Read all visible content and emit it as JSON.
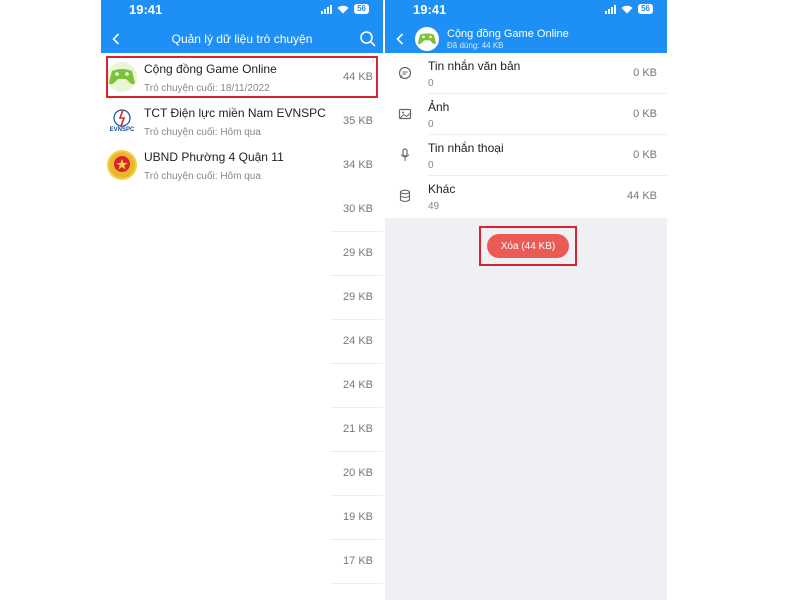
{
  "colors": {
    "header": "#1e90f5",
    "highlight": "#d9232e",
    "delete_button": "#ea5b55"
  },
  "left": {
    "status": {
      "time": "19:41",
      "battery": "56"
    },
    "header": {
      "title": "Quản lý dữ liệu trò chuyện",
      "back_icon": "chevron-left-icon",
      "search_icon": "search-icon"
    },
    "conversations": [
      {
        "name": "Cộng đồng Game Online",
        "last": "Trò chuyện cuối: 18/11/2022",
        "size": "44 KB",
        "avatar": "gamepad-icon"
      },
      {
        "name": "TCT Điện lực miền Nam EVNSPC",
        "last": "Trò chuyện cuối: Hôm qua",
        "size": "35 KB",
        "avatar": "evnspc-logo",
        "logo_text": "EVNSPC"
      },
      {
        "name": "UBND Phường 4 Quận 11",
        "last": "Trò chuyện cuối: Hôm qua",
        "size": "34 KB",
        "avatar": "emblem-icon"
      }
    ],
    "more_sizes": [
      "30 KB",
      "29 KB",
      "29 KB",
      "24 KB",
      "24 KB",
      "21 KB",
      "20 KB",
      "19 KB",
      "17 KB"
    ]
  },
  "right": {
    "status": {
      "time": "19:41",
      "battery": "56"
    },
    "header": {
      "title": "Cộng đồng Game Online",
      "subtitle": "Đã dùng: 44 KB",
      "back_icon": "chevron-left-icon"
    },
    "categories": [
      {
        "label": "Tin nhắn văn bản",
        "count": "0",
        "size": "0 KB",
        "icon": "message-icon"
      },
      {
        "label": "Ảnh",
        "count": "0",
        "size": "0 KB",
        "icon": "image-icon"
      },
      {
        "label": "Tin nhắn thoại",
        "count": "0",
        "size": "0 KB",
        "icon": "microphone-icon"
      },
      {
        "label": "Khác",
        "count": "49",
        "size": "44 KB",
        "icon": "database-icon"
      }
    ],
    "delete_button": "Xóa (44 KB)"
  }
}
